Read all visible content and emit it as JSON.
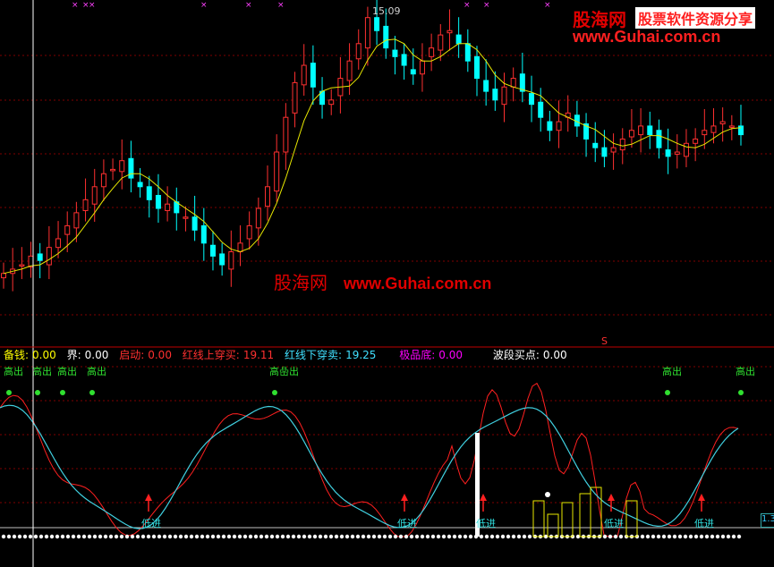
{
  "price_chart": {
    "max_label": "15.09",
    "watermark": {
      "cn": "股海网",
      "right": "股票软件资源分享",
      "url": "www.Guhai.com.cn"
    },
    "center_watermark": {
      "cn": "股海网",
      "url": "www.Guhai.com.cn"
    }
  },
  "indicator_bar": {
    "items": [
      {
        "label": "备钱:",
        "value": "0.00",
        "color": "#ffff00"
      },
      {
        "label": "界:",
        "value": "0.00",
        "color": "#ffffff"
      },
      {
        "label": "启动:",
        "value": "0.00",
        "color": "#ff3030"
      },
      {
        "label": "红线上穿买:",
        "value": "19.11",
        "color": "#ff3030"
      },
      {
        "label": "红线下穿卖:",
        "value": "19.25",
        "color": "#40e0ff"
      },
      {
        "label": "极品底:",
        "value": "0.00",
        "color": "#ff00ff"
      },
      {
        "label": "波段买点:",
        "value": "0.00",
        "color": "#ffffff"
      }
    ],
    "s_marker": "S"
  },
  "signals": {
    "high_out": "高出",
    "high_low_out": "高喦出",
    "low_in": "低进",
    "right_tag": "1.3"
  },
  "colors": {
    "up": "#ff3030",
    "down": "#00ffff",
    "ma": "#e8e800",
    "grid": "#800000",
    "osc_red": "#ff2020",
    "osc_cyan": "#40d0e0"
  },
  "chart_data": {
    "type": "candlestick",
    "candles_close_approx": [
      9.0,
      9.1,
      9.2,
      9.4,
      9.3,
      9.6,
      9.8,
      10.1,
      10.4,
      10.7,
      11.0,
      11.3,
      11.4,
      11.6,
      11.2,
      11.0,
      10.7,
      10.5,
      10.6,
      10.4,
      10.3,
      10.0,
      9.7,
      9.4,
      9.2,
      9.5,
      9.7,
      10.1,
      10.5,
      11.0,
      11.8,
      12.6,
      13.4,
      13.8,
      13.3,
      12.9,
      13.0,
      13.5,
      13.9,
      14.3,
      14.9,
      14.6,
      14.2,
      14.0,
      13.8,
      13.6,
      13.9,
      14.2,
      14.5,
      14.6,
      14.3,
      13.9,
      13.5,
      13.2,
      13.0,
      13.3,
      13.5,
      13.2,
      12.9,
      12.6,
      12.3,
      12.5,
      12.7,
      12.4,
      12.1,
      11.9,
      11.7,
      11.9,
      12.1,
      12.3,
      12.4,
      12.2,
      11.9,
      11.7,
      11.8,
      12.0,
      12.1,
      12.3,
      12.4,
      12.5,
      12.4,
      12.2
    ],
    "visible_labels": [
      "15.09"
    ],
    "lower_panel": {
      "label_items": [
        "备钱",
        "界",
        "启动",
        "红线上穿买",
        "红线下穿卖",
        "极品底",
        "波段买点"
      ],
      "signals": [
        "高出",
        "高出",
        "高出",
        "高出",
        "高喦出",
        "高出",
        "高出",
        "低进",
        "低进",
        "低进",
        "低进",
        "低进",
        "低进"
      ]
    }
  }
}
